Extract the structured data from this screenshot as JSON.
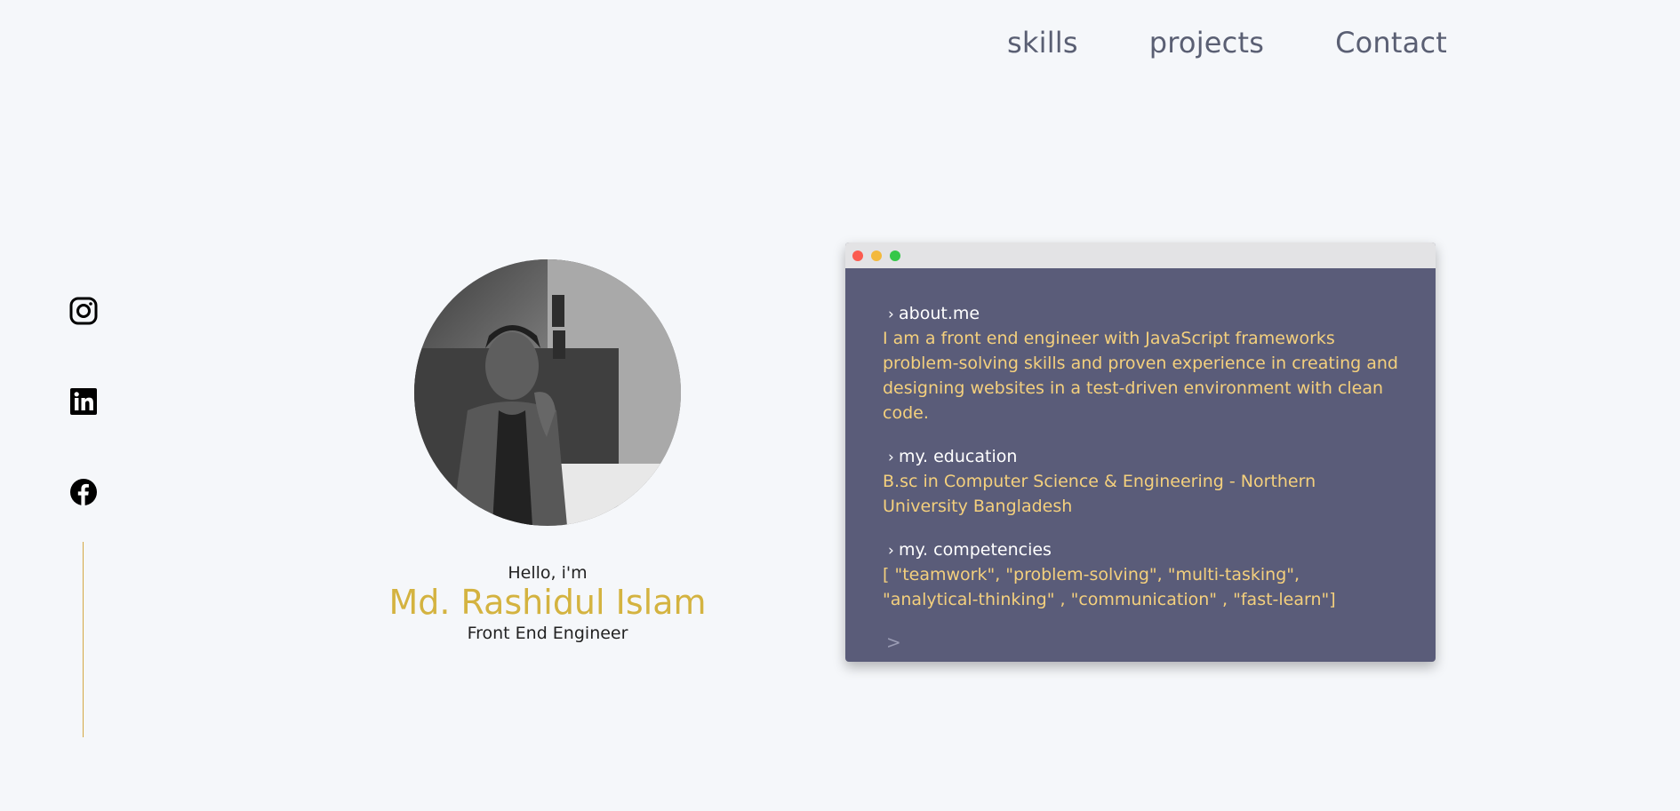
{
  "nav": {
    "items": [
      {
        "label": "skills"
      },
      {
        "label": "projects"
      },
      {
        "label": "Contact"
      }
    ]
  },
  "social": {
    "icons": [
      "instagram-icon",
      "linkedin-icon",
      "facebook-icon"
    ],
    "line_color": "#d4a843"
  },
  "profile": {
    "greeting": "Hello, i'm",
    "name": "Md. Rashidul Islam",
    "role": "Front End Engineer",
    "name_color": "#d4b340"
  },
  "terminal": {
    "bg_color": "#5a5c79",
    "sections": [
      {
        "prompt": "about.me",
        "output": "I am a front end engineer with JavaScript frameworks problem-solving skills and proven experience in creating and designing websites in a test-driven environment with clean code."
      },
      {
        "prompt": "my. education",
        "output": "B.sc in Computer Science & Engineering - Northern University Bangladesh"
      },
      {
        "prompt": "my. competencies",
        "output": "[ \"teamwork\", \"problem-solving\", \"multi-tasking\", \"analytical-thinking\" , \"communication\" , \"fast-learn\"]"
      }
    ],
    "prompt_symbol": "›",
    "empty_prompt": ">",
    "output_color": "#f4d07d"
  }
}
